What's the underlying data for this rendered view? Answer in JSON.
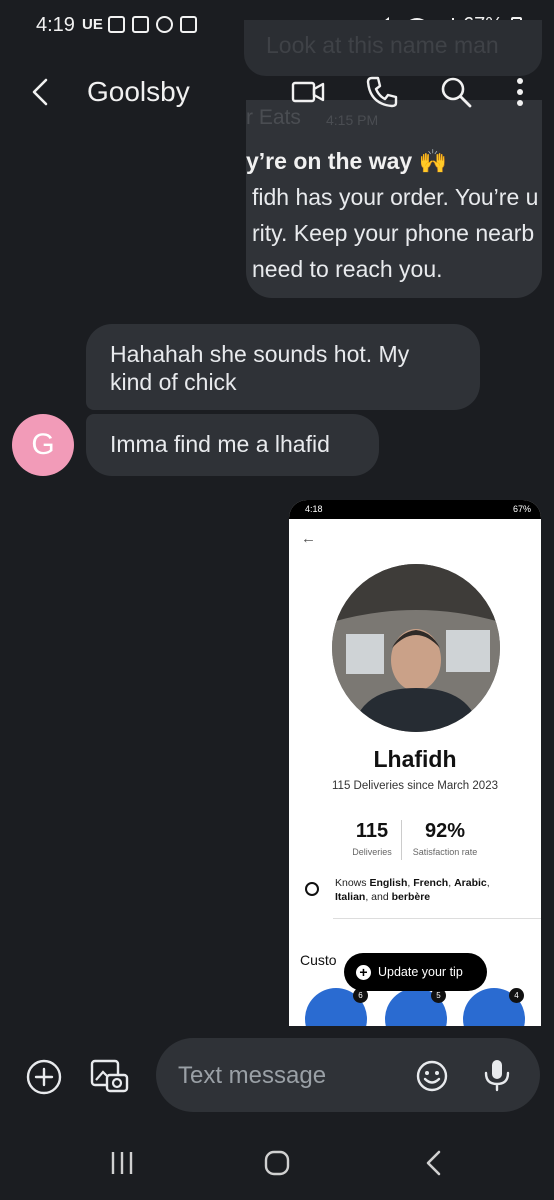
{
  "status_bar": {
    "time": "4:19",
    "carrier": "UE",
    "battery": "67%"
  },
  "ghost_message": "Look at this name man",
  "header": {
    "contact_name": "Goolsby"
  },
  "ubereats": {
    "sender": "r Eats",
    "time": "4:15 PM",
    "title": "y’re on the way 🙌",
    "line1": "fidh has your order. You’re u",
    "line2": "rity. Keep your phone nearb",
    "line3": "need to reach you."
  },
  "messages": [
    {
      "text": "Hahahah she sounds hot. My kind of chick"
    },
    {
      "text": "Imma find me a lhafid"
    }
  ],
  "avatar": {
    "initial": "G"
  },
  "screenshot": {
    "status_time": "4:18",
    "status_battery": "67%",
    "driver_name": "Lhafidh",
    "subtitle": "115 Deliveries since March 2023",
    "stats": [
      {
        "value": "115",
        "label": "Deliveries"
      },
      {
        "value": "92%",
        "label": "Satisfaction rate"
      }
    ],
    "languages": {
      "prefix": "Knows ",
      "l1": "English",
      "sep1": ", ",
      "l2": "French",
      "sep2": ", ",
      "l3": "Arabic",
      "sep3": ", ",
      "l4": "Italian",
      "sep4": ", and ",
      "l5": "berbère"
    },
    "customers_label": "Custo",
    "update_tip_label": "Update your tip",
    "badges": [
      "6",
      "5",
      "4"
    ]
  },
  "composer": {
    "placeholder": "Text message"
  },
  "colors": {
    "background": "#1b1d21",
    "bubble": "#2f3237",
    "avatar": "#f29bb8"
  }
}
